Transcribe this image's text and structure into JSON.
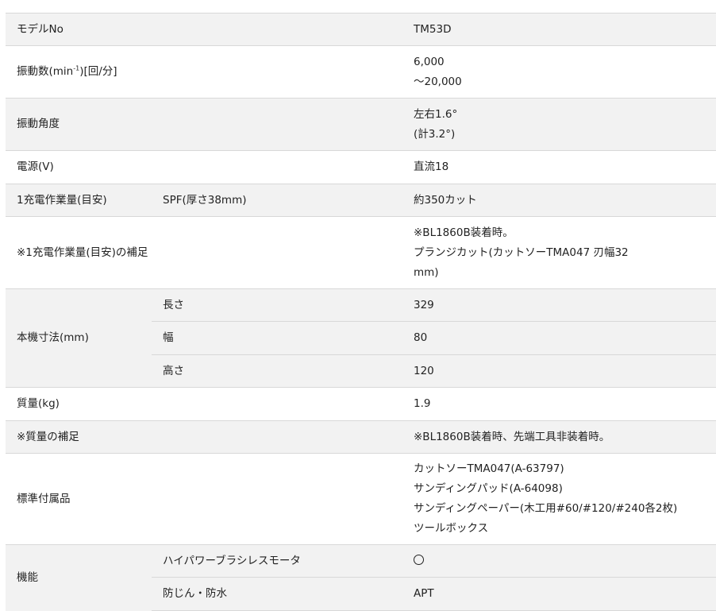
{
  "rows": {
    "model": {
      "label": "モデルNo",
      "value": "TM53D"
    },
    "vibration": {
      "label": "振動数(min",
      "label_sup": "-1",
      "label_tail": ")[回/分]",
      "lines": [
        "6,000",
        "～20,000"
      ]
    },
    "angle": {
      "label": "振動角度",
      "lines": [
        "左右1.6°",
        "(計3.2°)"
      ]
    },
    "power": {
      "label": "電源(V)",
      "value": "直流18"
    },
    "work": {
      "label": "1充電作業量(目安)",
      "sub": "SPF(厚さ38mm)",
      "value": "約350カット"
    },
    "work_note": {
      "label": "※1充電作業量(目安)の補足",
      "lines": [
        "※BL1860B装着時。",
        "プランジカット(カットソーTMA047 刃幅32",
        "mm)"
      ]
    },
    "dimensions": {
      "label": "本機寸法(mm)",
      "items": [
        {
          "sub": "長さ",
          "value": "329"
        },
        {
          "sub": "幅",
          "value": "80"
        },
        {
          "sub": "高さ",
          "value": "120"
        }
      ]
    },
    "mass": {
      "label": "質量(kg)",
      "value": "1.9"
    },
    "mass_note": {
      "label": "※質量の補足",
      "value": "※BL1860B装着時、先端工具非装着時。"
    },
    "accessories": {
      "label": "標準付属品",
      "lines": [
        "カットソーTMA047(A-63797)",
        "サンディングパッド(A-64098)",
        "サンディングペーパー(木工用#60/#120/#240各2枚)",
        "ツールボックス"
      ]
    },
    "features": {
      "label": "機能",
      "items": [
        {
          "sub": "ハイパワーブラシレスモータ",
          "value_icon": "circle-mark-icon"
        },
        {
          "sub": "防じん・防水",
          "value": "APT"
        }
      ]
    }
  }
}
